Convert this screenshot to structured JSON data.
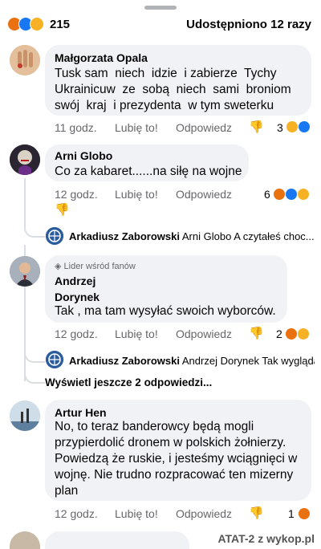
{
  "header": {
    "reaction_count": "215",
    "shares": "Udostępniono 12 razy"
  },
  "comments": [
    {
      "author": "Małgorzata Opala",
      "text": "Tusk sam  niech  idzie  i zabierze  Tychy\nUkrainicuw  ze  sobą  niech  sami  broniom\nswój  kraj  i prezydenta  w tym sweterku",
      "time": "11 godz.",
      "like": "Lubię to!",
      "reply": "Odpowiedz",
      "react_count": "3"
    },
    {
      "author": "Arni Globo",
      "text": "Co za kabaret......na siłę na wojne",
      "time": "12 godz.",
      "like": "Lubię to!",
      "reply": "Odpowiedz",
      "react_count": "6",
      "reply_author": "Arkadiusz Zaborowski",
      "reply_text": "Arni Globo A czytałeś choc..."
    },
    {
      "badge": "Lider wśród fanów",
      "author": "Andrzej\nDorynek",
      "text": "Tak , ma tam wysyłać swoich wyborców.",
      "time": "12 godz.",
      "like": "Lubię to!",
      "reply": "Odpowiedz",
      "react_count": "2",
      "reply_author": "Arkadiusz Zaborowski",
      "reply_text": "Andrzej Dorynek Tak wygląda",
      "more": "Wyświetl jeszcze 2 odpowiedzi..."
    },
    {
      "author": "Artur Hen",
      "text": "No, to teraz banderowcy będą mogli przypierdolić dronem w polskich żołnierzy. Powiedzą że ruskie, i jesteśmy wciągnięci w wojnę. Nie trudno rozpracować ten mizerny plan",
      "time": "12 godz.",
      "like": "Lubię to!",
      "reply": "Odpowiedz",
      "react_count": "1"
    }
  ],
  "watermark": "ATAT-2  z  wykop.pl",
  "colors": {
    "angry": "#e9710f",
    "like": "#1877f2",
    "haha": "#f7b125",
    "bubble": "#f0f2f5",
    "meta": "#65676b"
  }
}
